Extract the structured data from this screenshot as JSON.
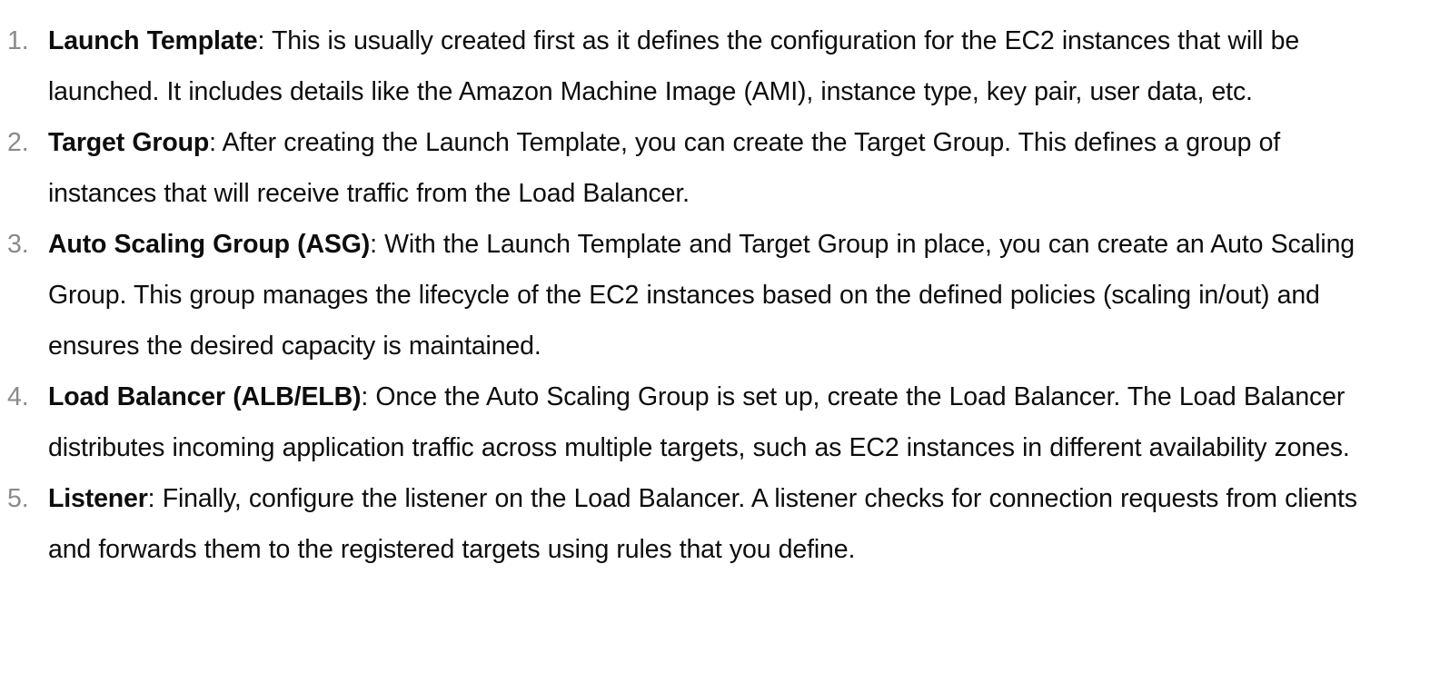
{
  "steps": [
    {
      "number": "1.",
      "term": "Launch Template",
      "description": ": This is usually created first as it defines the configuration for the EC2 instances that will be launched. It includes details like the Amazon Machine Image (AMI), instance type, key pair, user data, etc."
    },
    {
      "number": "2.",
      "term": "Target Group",
      "description": ": After creating the Launch Template, you can create the Target Group. This defines a group of instances that will receive traffic from the Load Balancer."
    },
    {
      "number": "3.",
      "term": "Auto Scaling Group (ASG)",
      "description": ": With the Launch Template and Target Group in place, you can create an Auto Scaling Group. This group manages the lifecycle of the EC2 instances based on the defined policies (scaling in/out) and ensures the desired capacity is maintained."
    },
    {
      "number": "4.",
      "term": "Load Balancer (ALB/ELB)",
      "description": ": Once the Auto Scaling Group is set up, create the Load Balancer. The Load Balancer distributes incoming application traffic across multiple targets, such as EC2 instances in different availability zones."
    },
    {
      "number": "5.",
      "term": "Listener",
      "description": ": Finally, configure the listener on the Load Balancer. A listener checks for connection requests from clients and forwards them to the registered targets using rules that you define."
    }
  ]
}
